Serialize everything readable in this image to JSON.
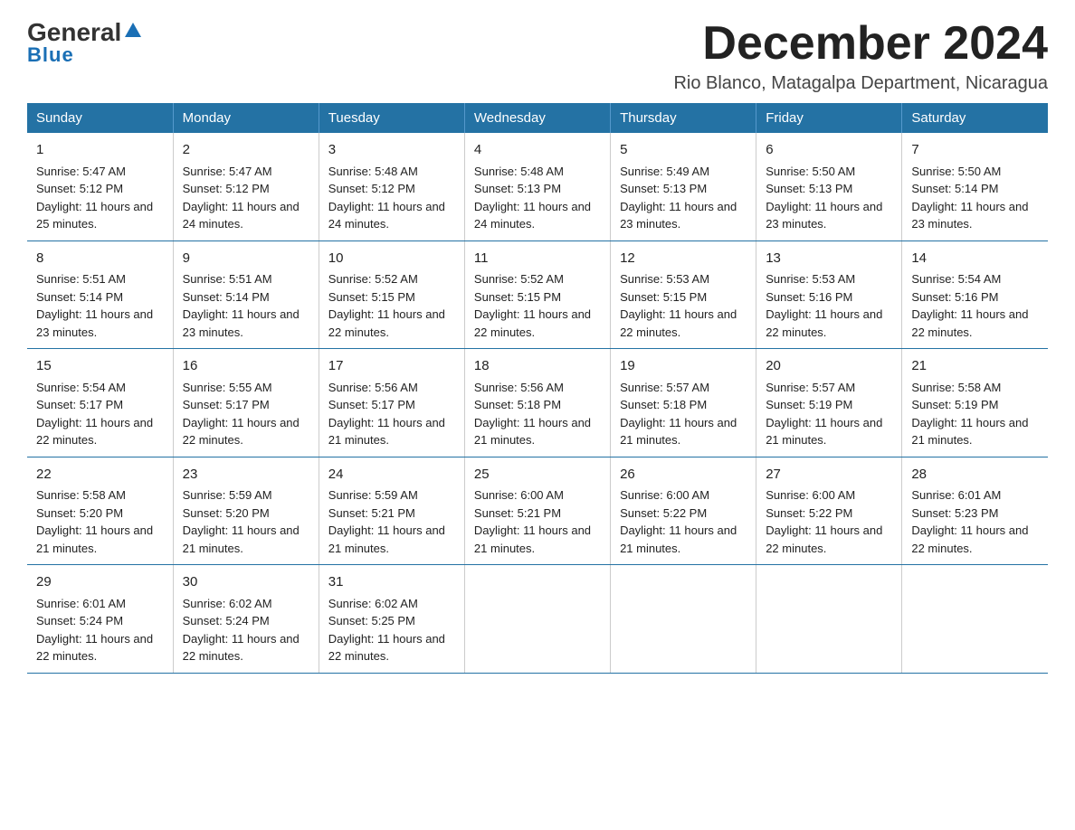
{
  "header": {
    "logo_general": "General",
    "logo_blue": "Blue",
    "title": "December 2024",
    "subtitle": "Rio Blanco, Matagalpa Department, Nicaragua"
  },
  "columns": [
    "Sunday",
    "Monday",
    "Tuesday",
    "Wednesday",
    "Thursday",
    "Friday",
    "Saturday"
  ],
  "weeks": [
    [
      {
        "day": "1",
        "sunrise": "Sunrise: 5:47 AM",
        "sunset": "Sunset: 5:12 PM",
        "daylight": "Daylight: 11 hours and 25 minutes."
      },
      {
        "day": "2",
        "sunrise": "Sunrise: 5:47 AM",
        "sunset": "Sunset: 5:12 PM",
        "daylight": "Daylight: 11 hours and 24 minutes."
      },
      {
        "day": "3",
        "sunrise": "Sunrise: 5:48 AM",
        "sunset": "Sunset: 5:12 PM",
        "daylight": "Daylight: 11 hours and 24 minutes."
      },
      {
        "day": "4",
        "sunrise": "Sunrise: 5:48 AM",
        "sunset": "Sunset: 5:13 PM",
        "daylight": "Daylight: 11 hours and 24 minutes."
      },
      {
        "day": "5",
        "sunrise": "Sunrise: 5:49 AM",
        "sunset": "Sunset: 5:13 PM",
        "daylight": "Daylight: 11 hours and 23 minutes."
      },
      {
        "day": "6",
        "sunrise": "Sunrise: 5:50 AM",
        "sunset": "Sunset: 5:13 PM",
        "daylight": "Daylight: 11 hours and 23 minutes."
      },
      {
        "day": "7",
        "sunrise": "Sunrise: 5:50 AM",
        "sunset": "Sunset: 5:14 PM",
        "daylight": "Daylight: 11 hours and 23 minutes."
      }
    ],
    [
      {
        "day": "8",
        "sunrise": "Sunrise: 5:51 AM",
        "sunset": "Sunset: 5:14 PM",
        "daylight": "Daylight: 11 hours and 23 minutes."
      },
      {
        "day": "9",
        "sunrise": "Sunrise: 5:51 AM",
        "sunset": "Sunset: 5:14 PM",
        "daylight": "Daylight: 11 hours and 23 minutes."
      },
      {
        "day": "10",
        "sunrise": "Sunrise: 5:52 AM",
        "sunset": "Sunset: 5:15 PM",
        "daylight": "Daylight: 11 hours and 22 minutes."
      },
      {
        "day": "11",
        "sunrise": "Sunrise: 5:52 AM",
        "sunset": "Sunset: 5:15 PM",
        "daylight": "Daylight: 11 hours and 22 minutes."
      },
      {
        "day": "12",
        "sunrise": "Sunrise: 5:53 AM",
        "sunset": "Sunset: 5:15 PM",
        "daylight": "Daylight: 11 hours and 22 minutes."
      },
      {
        "day": "13",
        "sunrise": "Sunrise: 5:53 AM",
        "sunset": "Sunset: 5:16 PM",
        "daylight": "Daylight: 11 hours and 22 minutes."
      },
      {
        "day": "14",
        "sunrise": "Sunrise: 5:54 AM",
        "sunset": "Sunset: 5:16 PM",
        "daylight": "Daylight: 11 hours and 22 minutes."
      }
    ],
    [
      {
        "day": "15",
        "sunrise": "Sunrise: 5:54 AM",
        "sunset": "Sunset: 5:17 PM",
        "daylight": "Daylight: 11 hours and 22 minutes."
      },
      {
        "day": "16",
        "sunrise": "Sunrise: 5:55 AM",
        "sunset": "Sunset: 5:17 PM",
        "daylight": "Daylight: 11 hours and 22 minutes."
      },
      {
        "day": "17",
        "sunrise": "Sunrise: 5:56 AM",
        "sunset": "Sunset: 5:17 PM",
        "daylight": "Daylight: 11 hours and 21 minutes."
      },
      {
        "day": "18",
        "sunrise": "Sunrise: 5:56 AM",
        "sunset": "Sunset: 5:18 PM",
        "daylight": "Daylight: 11 hours and 21 minutes."
      },
      {
        "day": "19",
        "sunrise": "Sunrise: 5:57 AM",
        "sunset": "Sunset: 5:18 PM",
        "daylight": "Daylight: 11 hours and 21 minutes."
      },
      {
        "day": "20",
        "sunrise": "Sunrise: 5:57 AM",
        "sunset": "Sunset: 5:19 PM",
        "daylight": "Daylight: 11 hours and 21 minutes."
      },
      {
        "day": "21",
        "sunrise": "Sunrise: 5:58 AM",
        "sunset": "Sunset: 5:19 PM",
        "daylight": "Daylight: 11 hours and 21 minutes."
      }
    ],
    [
      {
        "day": "22",
        "sunrise": "Sunrise: 5:58 AM",
        "sunset": "Sunset: 5:20 PM",
        "daylight": "Daylight: 11 hours and 21 minutes."
      },
      {
        "day": "23",
        "sunrise": "Sunrise: 5:59 AM",
        "sunset": "Sunset: 5:20 PM",
        "daylight": "Daylight: 11 hours and 21 minutes."
      },
      {
        "day": "24",
        "sunrise": "Sunrise: 5:59 AM",
        "sunset": "Sunset: 5:21 PM",
        "daylight": "Daylight: 11 hours and 21 minutes."
      },
      {
        "day": "25",
        "sunrise": "Sunrise: 6:00 AM",
        "sunset": "Sunset: 5:21 PM",
        "daylight": "Daylight: 11 hours and 21 minutes."
      },
      {
        "day": "26",
        "sunrise": "Sunrise: 6:00 AM",
        "sunset": "Sunset: 5:22 PM",
        "daylight": "Daylight: 11 hours and 21 minutes."
      },
      {
        "day": "27",
        "sunrise": "Sunrise: 6:00 AM",
        "sunset": "Sunset: 5:22 PM",
        "daylight": "Daylight: 11 hours and 22 minutes."
      },
      {
        "day": "28",
        "sunrise": "Sunrise: 6:01 AM",
        "sunset": "Sunset: 5:23 PM",
        "daylight": "Daylight: 11 hours and 22 minutes."
      }
    ],
    [
      {
        "day": "29",
        "sunrise": "Sunrise: 6:01 AM",
        "sunset": "Sunset: 5:24 PM",
        "daylight": "Daylight: 11 hours and 22 minutes."
      },
      {
        "day": "30",
        "sunrise": "Sunrise: 6:02 AM",
        "sunset": "Sunset: 5:24 PM",
        "daylight": "Daylight: 11 hours and 22 minutes."
      },
      {
        "day": "31",
        "sunrise": "Sunrise: 6:02 AM",
        "sunset": "Sunset: 5:25 PM",
        "daylight": "Daylight: 11 hours and 22 minutes."
      },
      null,
      null,
      null,
      null
    ]
  ]
}
